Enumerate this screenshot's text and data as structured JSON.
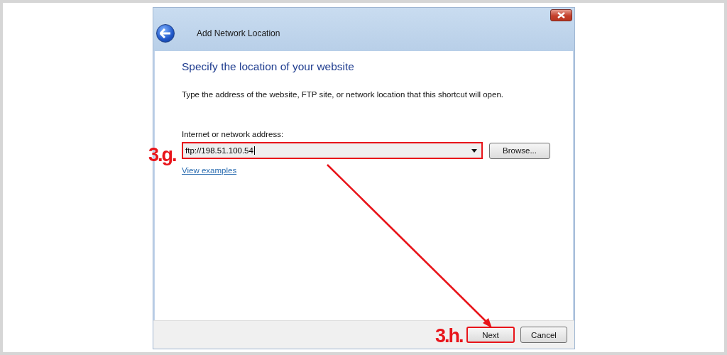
{
  "window": {
    "title": "Add Network Location"
  },
  "heading": "Specify the location of your website",
  "description": "Type the address of the website, FTP site, or network location that this shortcut will open.",
  "address_field": {
    "label": "Internet or network address:",
    "value": "ftp://198.51.100.54",
    "highlighted": true
  },
  "browse_button": "Browse...",
  "link": "View examples",
  "buttons": [
    {
      "label": "Next",
      "highlighted": true
    },
    {
      "label": "Cancel",
      "highlighted": false
    }
  ],
  "annotations": [
    {
      "label": "3.g."
    },
    {
      "label": "3.h."
    }
  ]
}
